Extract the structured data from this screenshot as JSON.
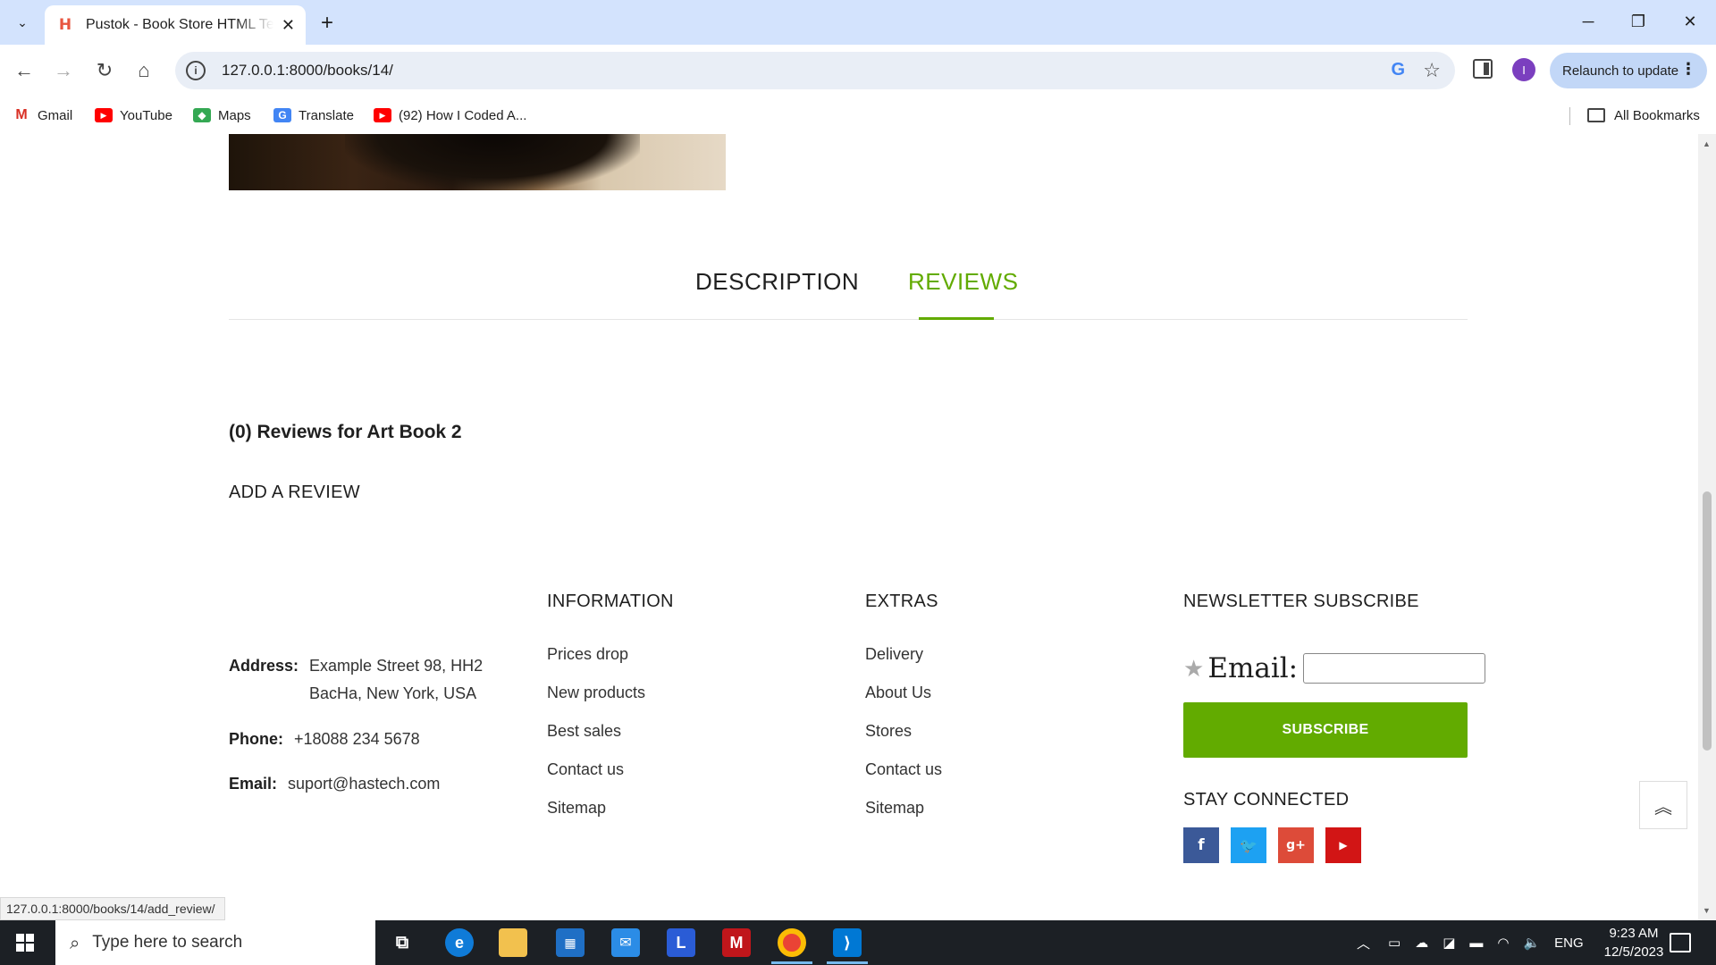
{
  "browser": {
    "tab_title": "Pustok - Book Store HTML Template",
    "url": "127.0.0.1:8000/books/14/",
    "relaunch_label": "Relaunch to update",
    "profile_initial": "I",
    "bookmarks": [
      {
        "label": "Gmail"
      },
      {
        "label": "YouTube"
      },
      {
        "label": "Maps"
      },
      {
        "label": "Translate"
      },
      {
        "label": "(92) How I Coded A..."
      }
    ],
    "all_bookmarks_label": "All Bookmarks",
    "status_url": "127.0.0.1:8000/books/14/add_review/"
  },
  "product_tabs": {
    "description_label": "DESCRIPTION",
    "reviews_label": "REVIEWS",
    "active": "reviews"
  },
  "reviews": {
    "heading": "(0) Reviews for Art Book 2",
    "add_review_label": "ADD A REVIEW"
  },
  "footer": {
    "contact": {
      "address_label": "Address:",
      "address_line1": "Example Street 98, HH2",
      "address_line2": "BacHa, New York, USA",
      "phone_label": "Phone:",
      "phone_value": "+18088 234 5678",
      "email_label": "Email:",
      "email_value": "suport@hastech.com"
    },
    "information": {
      "title": "INFORMATION",
      "links": [
        "Prices drop",
        "New products",
        "Best sales",
        "Contact us",
        "Sitemap"
      ]
    },
    "extras": {
      "title": "EXTRAS",
      "links": [
        "Delivery",
        "About Us",
        "Stores",
        "Contact us",
        "Sitemap"
      ]
    },
    "newsletter": {
      "title": "NEWSLETTER SUBSCRIBE",
      "email_label": "Email:",
      "email_value": "",
      "subscribe_label": "SUBSCRIBE"
    },
    "social": {
      "title": "STAY CONNECTED",
      "icons": [
        "facebook-icon",
        "twitter-icon",
        "google-plus-icon",
        "youtube-icon"
      ]
    }
  },
  "colors": {
    "accent_green": "#62ab00",
    "facebook": "#3b5998",
    "twitter": "#1da1f2",
    "google_plus": "#dd4b39",
    "youtube": "#d21515"
  },
  "taskbar": {
    "search_placeholder": "Type here to search",
    "language": "ENG",
    "time": "9:23 AM",
    "date": "12/5/2023"
  }
}
